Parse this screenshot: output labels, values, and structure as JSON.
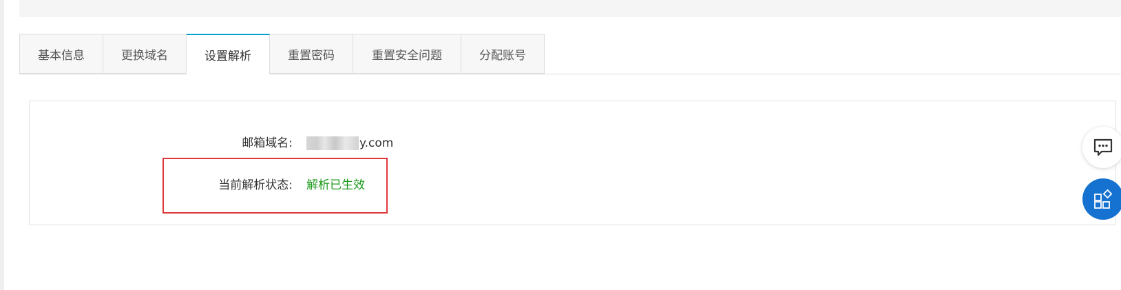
{
  "tabs": [
    {
      "label": "基本信息",
      "active": false
    },
    {
      "label": "更换域名",
      "active": false
    },
    {
      "label": "设置解析",
      "active": true
    },
    {
      "label": "重置密码",
      "active": false
    },
    {
      "label": "重置安全问题",
      "active": false
    },
    {
      "label": "分配账号",
      "active": false
    }
  ],
  "panel": {
    "domain_label": "邮箱域名:",
    "domain_value_suffix": "y.com",
    "status_label": "当前解析状态:",
    "status_value": "解析已生效"
  },
  "icons": {
    "chat": "chat-bubble-icon",
    "apps": "apps-grid-icon"
  },
  "colors": {
    "tab_active_accent": "#00a2ca",
    "status_ok": "#1b9a1b",
    "highlight": "#e0363b",
    "apps_button": "#1672d0"
  }
}
